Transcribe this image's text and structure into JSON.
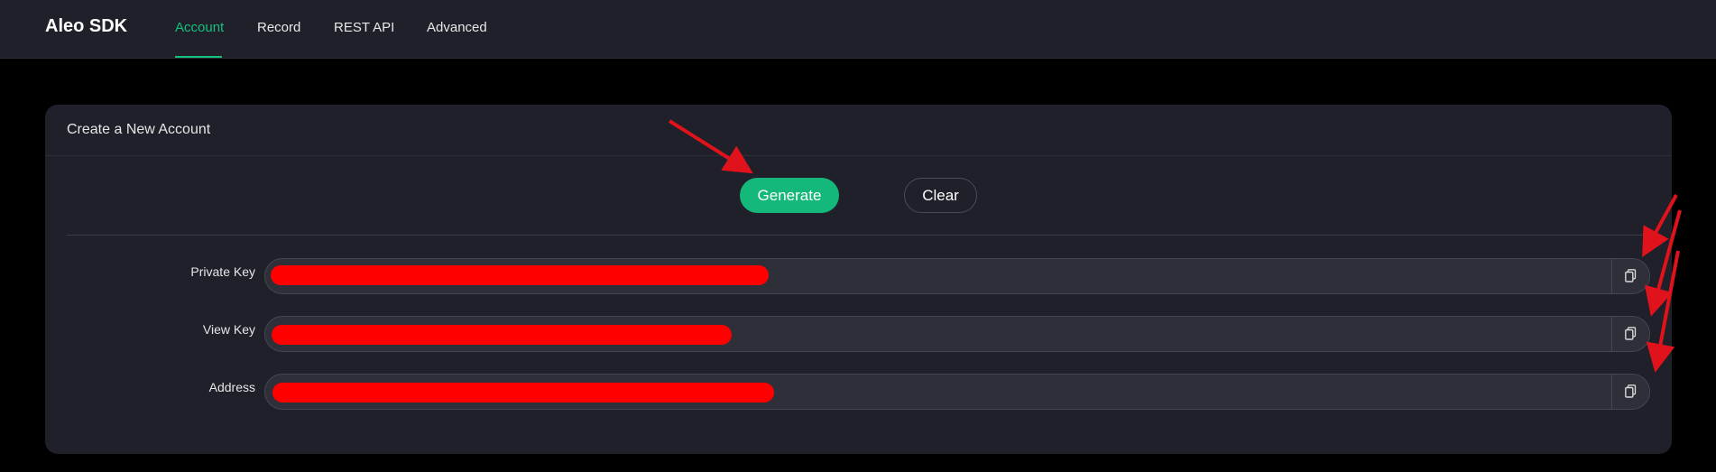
{
  "app": {
    "brand": "Aleo SDK"
  },
  "nav": {
    "items": [
      {
        "label": "Account",
        "active": true
      },
      {
        "label": "Record",
        "active": false
      },
      {
        "label": "REST API",
        "active": false
      },
      {
        "label": "Advanced",
        "active": false
      }
    ]
  },
  "card": {
    "title": "Create a New Account",
    "generate_label": "Generate",
    "clear_label": "Clear",
    "fields": [
      {
        "label": "Private Key",
        "value": "",
        "redacted": true,
        "icon": "copy-icon"
      },
      {
        "label": "View Key",
        "value": "",
        "redacted": true,
        "icon": "copy-icon"
      },
      {
        "label": "Address",
        "value": "",
        "redacted": true,
        "icon": "copy-icon"
      }
    ]
  },
  "colors": {
    "accent": "#14c07f",
    "background": "#000000",
    "surface": "#1f2029",
    "field_bg": "#2e2f39",
    "redaction": "#ff0000",
    "annotation_arrow": "#e0121b"
  }
}
